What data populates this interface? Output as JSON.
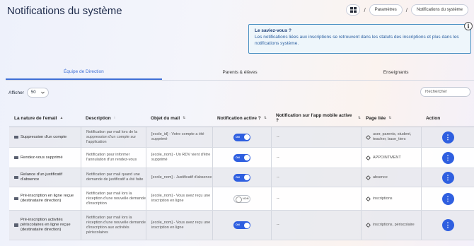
{
  "page": {
    "title": "Notifications du système"
  },
  "breadcrumb": {
    "home_icon": "grid-icon",
    "separator": "/",
    "items": [
      "Paramètres",
      "Notifications du système"
    ]
  },
  "info": {
    "title": "Le saviez-vous ?",
    "text": "Les notifications liées aux inscriptions se retrouvent dans les statuts des inscriptions et plus dans les notifications système.",
    "icon_glyph": "i"
  },
  "tabs": [
    {
      "label": "Équipe de Direction",
      "active": true
    },
    {
      "label": "Parents & élèves",
      "active": false
    },
    {
      "label": "Enseignants",
      "active": false
    }
  ],
  "controls": {
    "show_label": "Afficher",
    "page_size": "50",
    "search_placeholder": "Rechercher"
  },
  "table": {
    "headers": {
      "nature": "La nature de l'email",
      "description": "Description",
      "subject": "Objet du mail",
      "active": "Notification active ?",
      "mobile": "Notification sur l'app mobile active ?",
      "page": "Page liée",
      "action": "Action"
    },
    "toggle_on_label": "ON",
    "toggle_off_label": "NON",
    "action_glyph": "⋮",
    "rows": [
      {
        "nature": "Suppression d'un compte",
        "description": "Notification par mail lors de la suppression d'un compte sur l'application",
        "subject": "[ecole_id] - Votre compte a été supprimé",
        "active": true,
        "mobile": "--",
        "page": "user, parents, student, teacher, base_tiers"
      },
      {
        "nature": "Rendez-vous supprimé",
        "description": "Notification pour informer l'annulation d'un rendez-vous",
        "subject": "[ecole_nom] - Un RDV vient d'être supprimé",
        "active": true,
        "mobile": "--",
        "page": "APPOINTMENT"
      },
      {
        "nature": "Relance d'un justificatif d'absence",
        "description": "Notification par mail quand une demande de justificatif a été faite",
        "subject": "[ecole_nom] - Justificatif d'absence",
        "active": true,
        "mobile": "--",
        "page": "absence"
      },
      {
        "nature": "Pré-inscription en ligne reçue (destinataire direction)",
        "description": "Notification par mail lors la réception d'une nouvelle demande d'inscription",
        "subject": "[ecole_nom] - Vous avez reçu une inscription en ligne",
        "active": false,
        "mobile": "--",
        "page": "inscriptions"
      },
      {
        "nature": "Pré-inscription activités périscolaires en ligne reçue (destinataire direction)",
        "description": "Notification par mail lors la réception d'une nouvelle demande d'inscription aux activités périscolaires",
        "subject": "[ecole_nom] - Vous avez reçu une inscription en ligne",
        "active": true,
        "mobile": "--",
        "page": "inscriptions, périscolaire"
      }
    ]
  },
  "colors": {
    "accent": "#2f5fe0",
    "tab_active": "#3f6fd6",
    "info_border": "#4a90c2"
  }
}
